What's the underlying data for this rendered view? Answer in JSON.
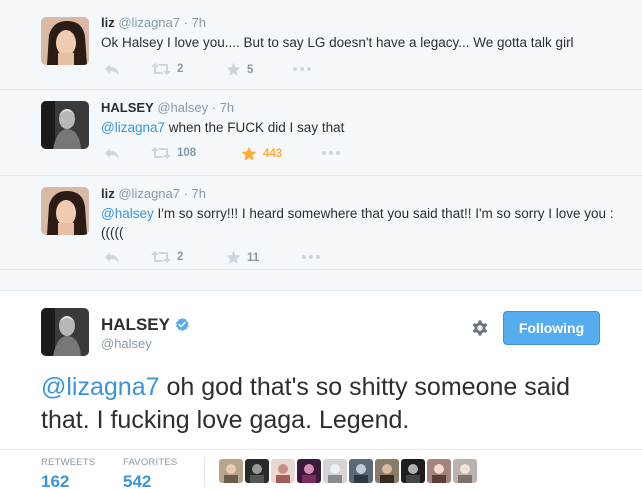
{
  "replies": [
    {
      "name": "liz",
      "handle": "@lizagna7",
      "time": "· 7h",
      "mention": "",
      "text": "Ok Halsey I love you.... But to say LG doesn't have a legacy... We gotta talk girl",
      "retweets": "2",
      "favorites": "5",
      "favorited": false
    },
    {
      "name": "HALSEY",
      "handle": "@halsey",
      "time": "· 7h",
      "mention": "@lizagna7",
      "text": " when the FUCK did I say that",
      "retweets": "108",
      "favorites": "443",
      "favorited": true
    },
    {
      "name": "liz",
      "handle": "@lizagna7",
      "time": "· 7h",
      "mention": "@halsey",
      "text": " I'm so sorry!!! I heard somewhere that you said that!! I'm so sorry I love you :(((((",
      "retweets": "2",
      "favorites": "11",
      "favorited": false
    }
  ],
  "main_tweet": {
    "name": "HALSEY",
    "handle": "@halsey",
    "follow_label": "Following",
    "mention": "@lizagna7",
    "text": " oh god that's so shitty someone said that. I fucking love gaga. Legend.",
    "retweets_label": "RETWEETS",
    "retweets": "162",
    "favorites_label": "FAVORITES",
    "favorites": "542"
  },
  "colors": {
    "link": "#3b94d9",
    "button": "#55acee",
    "favorite_active": "#ffac33",
    "verified": "#55acee"
  },
  "icons": [
    "reply-icon",
    "retweet-icon",
    "favorite-star-icon",
    "more-dots-icon",
    "gear-icon",
    "verified-badge-icon"
  ]
}
